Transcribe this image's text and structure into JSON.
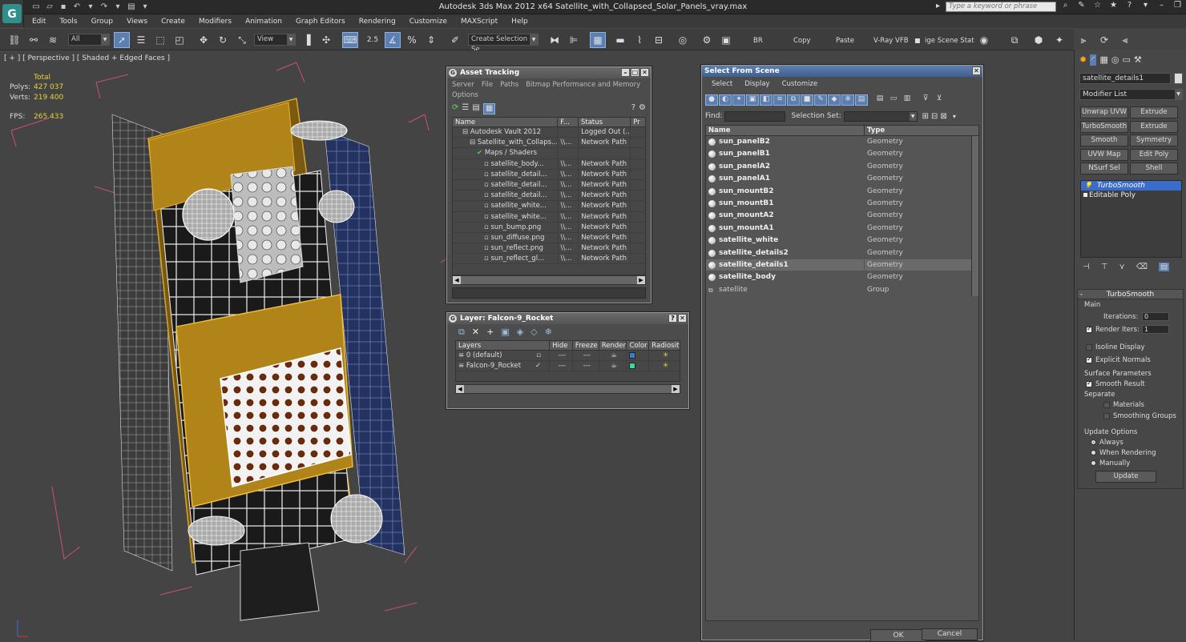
{
  "app": {
    "title": "Autodesk 3ds Max  2012 x64     Satellite_with_Collapsed_Solar_Panels_vray.max",
    "search_placeholder": "Type a keyword or phrase"
  },
  "menu": [
    "Edit",
    "Tools",
    "Group",
    "Views",
    "Create",
    "Modifiers",
    "Animation",
    "Graph Editors",
    "Rendering",
    "Customize",
    "MAXScript",
    "Help"
  ],
  "toolbar": {
    "filter_value": "All",
    "ref_coord": "View",
    "snap_angle": "2.5",
    "selection_set": "Create Selection Se",
    "br": "BR",
    "copy": "Copy",
    "paste": "Paste",
    "vray_vfb": "V-Ray VFB",
    "image_scene": "ige Scene Stat"
  },
  "viewport": {
    "label": "[ + ] [ Perspective ] [ Shaded + Edged Faces ]",
    "total_label": "Total",
    "polys_label": "Polys:",
    "polys": "427 037",
    "verts_label": "Verts:",
    "verts": "219 400",
    "fps_label": "FPS:",
    "fps": "265.433"
  },
  "asset_tracking": {
    "title": "Asset Tracking",
    "menu": [
      "Server",
      "File",
      "Paths",
      "Bitmap Performance and Memory"
    ],
    "menu2": "Options",
    "headers": [
      "Name",
      "F...",
      "Status",
      "Pr"
    ],
    "rows": [
      {
        "indent": 1,
        "name": "Autodesk Vault 2012",
        "f": "",
        "status": "Logged Out (..."
      },
      {
        "indent": 2,
        "name": "Satellite_with_Collaps...",
        "f": "\\\\...",
        "status": "Network Path"
      },
      {
        "indent": 3,
        "name": "Maps / Shaders",
        "f": "",
        "status": ""
      },
      {
        "indent": 4,
        "name": "satellite_body...",
        "f": "\\\\...",
        "status": "Network Path"
      },
      {
        "indent": 4,
        "name": "satellite_detail...",
        "f": "\\\\...",
        "status": "Network Path"
      },
      {
        "indent": 4,
        "name": "satellite_detail...",
        "f": "\\\\...",
        "status": "Network Path"
      },
      {
        "indent": 4,
        "name": "satellite_detail...",
        "f": "\\\\...",
        "status": "Network Path"
      },
      {
        "indent": 4,
        "name": "satellite_white...",
        "f": "\\\\...",
        "status": "Network Path"
      },
      {
        "indent": 4,
        "name": "satellite_white...",
        "f": "\\\\...",
        "status": "Network Path"
      },
      {
        "indent": 4,
        "name": "sun_bump.png",
        "f": "\\\\...",
        "status": "Network Path"
      },
      {
        "indent": 4,
        "name": "sun_diffuse.png",
        "f": "\\\\...",
        "status": "Network Path"
      },
      {
        "indent": 4,
        "name": "sun_reflect.png",
        "f": "\\\\...",
        "status": "Network Path"
      },
      {
        "indent": 4,
        "name": "sun_reflect_gl...",
        "f": "\\\\...",
        "status": "Network Path"
      }
    ]
  },
  "layer": {
    "title": "Layer: Falcon-9_Rocket",
    "headers": [
      "Layers",
      "Hide",
      "Freeze",
      "Render",
      "Color",
      "Radiosity"
    ],
    "rows": [
      {
        "name": "0 (default)",
        "color": "#3a7bd5"
      },
      {
        "name": "Falcon-9_Rocket",
        "color": "#3fd6a0"
      }
    ]
  },
  "sfs": {
    "title": "Select From Scene",
    "menu": [
      "Select",
      "Display",
      "Customize"
    ],
    "find_label": "Find:",
    "selset_label": "Selection Set:",
    "headers": [
      "Name",
      "Type"
    ],
    "rows": [
      {
        "name": "sun_panelB2",
        "type": "Geometry"
      },
      {
        "name": "sun_panelB1",
        "type": "Geometry"
      },
      {
        "name": "sun_panelA2",
        "type": "Geometry"
      },
      {
        "name": "sun_panelA1",
        "type": "Geometry"
      },
      {
        "name": "sun_mountB2",
        "type": "Geometry"
      },
      {
        "name": "sun_mountB1",
        "type": "Geometry"
      },
      {
        "name": "sun_mountA2",
        "type": "Geometry"
      },
      {
        "name": "sun_mountA1",
        "type": "Geometry"
      },
      {
        "name": "satellite_white",
        "type": "Geometry"
      },
      {
        "name": "satellite_details2",
        "type": "Geometry"
      },
      {
        "name": "satellite_details1",
        "type": "Geometry",
        "selected": true
      },
      {
        "name": "satellite_body",
        "type": "Geometry"
      },
      {
        "name": "satellite",
        "type": "Group",
        "group": true
      }
    ],
    "ok": "OK",
    "cancel": "Cancel"
  },
  "command_panel": {
    "object_name": "satellite_details1",
    "modifier_list": "Modifier List",
    "buttons": [
      [
        "Unwrap UVW",
        "Extrude"
      ],
      [
        "TurboSmooth",
        "Extrude"
      ],
      [
        "Smooth",
        "Symmetry"
      ],
      [
        "UVW Map",
        "Edit Poly"
      ],
      [
        "NSurf Sel",
        "Shell"
      ]
    ],
    "stack": [
      "TurboSmooth",
      "Editable Poly"
    ],
    "rollout": "TurboSmooth",
    "main": "Main",
    "iterations_label": "Iterations:",
    "iterations": "0",
    "render_iters_label": "Render Iters:",
    "render_iters": "1",
    "isoline": "Isoline Display",
    "explicit": "Explicit Normals",
    "surface": "Surface Parameters",
    "smooth_result": "Smooth Result",
    "separate": "Separate",
    "materials": "Materials",
    "smoothing_groups": "Smoothing Groups",
    "update_options": "Update Options",
    "always": "Always",
    "when_rendering": "When Rendering",
    "manually": "Manually",
    "update": "Update"
  }
}
